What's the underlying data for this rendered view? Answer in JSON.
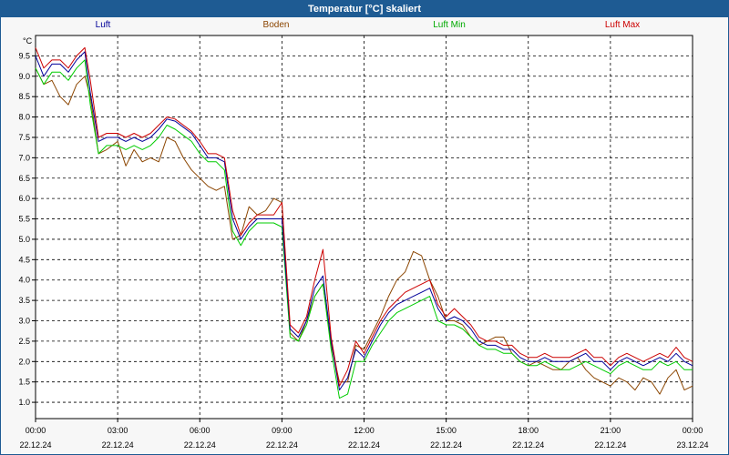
{
  "window": {
    "title": "Temperatur [°C] skaliert"
  },
  "colors": {
    "luft": "#000099",
    "boden": "#8b4500",
    "luft_min": "#00cc00",
    "luft_max": "#cc0000",
    "title_bar": "#1e5b93",
    "grid": "#000000"
  },
  "chart_data": {
    "type": "line",
    "title": "Temperatur [°C] skaliert",
    "ylabel": "°C",
    "xlabel": "",
    "ylim": [
      0.6,
      10.0
    ],
    "xlim": [
      0,
      24
    ],
    "grid": true,
    "legend_placement": "top",
    "y_ticks": [
      "1.0",
      "1.5",
      "2.0",
      "2.5",
      "3.0",
      "3.5",
      "4.0",
      "4.5",
      "5.0",
      "5.5",
      "6.0",
      "6.5",
      "7.0",
      "7.5",
      "8.0",
      "8.5",
      "9.0",
      "9.5"
    ],
    "y_tick_values": [
      1.0,
      1.5,
      2.0,
      2.5,
      3.0,
      3.5,
      4.0,
      4.5,
      5.0,
      5.5,
      6.0,
      6.5,
      7.0,
      7.5,
      8.0,
      8.5,
      9.0,
      9.5
    ],
    "x_ticks": [
      {
        "time": "00:00",
        "date": "22.12.24"
      },
      {
        "time": "03:00",
        "date": "22.12.24"
      },
      {
        "time": "06:00",
        "date": "22.12.24"
      },
      {
        "time": "09:00",
        "date": "22.12.24"
      },
      {
        "time": "12:00",
        "date": "22.12.24"
      },
      {
        "time": "15:00",
        "date": "22.12.24"
      },
      {
        "time": "18:00",
        "date": "22.12.24"
      },
      {
        "time": "21:00",
        "date": "22.12.24"
      },
      {
        "time": "00:00",
        "date": "23.12.24"
      }
    ],
    "series": [
      {
        "name": "Luft",
        "x": [
          0,
          0.3,
          0.6,
          0.9,
          1.2,
          1.5,
          1.8,
          2.0,
          2.3,
          2.6,
          3.0,
          3.3,
          3.6,
          3.9,
          4.2,
          4.5,
          4.8,
          5.1,
          5.4,
          5.7,
          6.0,
          6.3,
          6.6,
          6.9,
          7.2,
          7.5,
          7.8,
          8.1,
          8.4,
          8.7,
          9.0,
          9.3,
          9.6,
          9.9,
          10.2,
          10.5,
          10.8,
          11.1,
          11.4,
          11.7,
          12.0,
          12.3,
          12.6,
          12.9,
          13.2,
          13.5,
          13.8,
          14.1,
          14.4,
          14.7,
          15.0,
          15.3,
          15.6,
          15.9,
          16.2,
          16.5,
          16.8,
          17.1,
          17.4,
          17.7,
          18.0,
          18.3,
          18.6,
          18.9,
          19.2,
          19.5,
          19.8,
          20.1,
          20.4,
          20.7,
          21.0,
          21.3,
          21.6,
          21.9,
          22.2,
          22.5,
          22.8,
          23.1,
          23.4,
          23.7,
          24.0
        ],
        "values": [
          9.5,
          9.0,
          9.3,
          9.3,
          9.1,
          9.4,
          9.6,
          8.6,
          7.4,
          7.5,
          7.5,
          7.4,
          7.5,
          7.4,
          7.5,
          7.7,
          7.95,
          7.9,
          7.75,
          7.6,
          7.3,
          7.0,
          7.0,
          6.9,
          5.5,
          5.0,
          5.3,
          5.5,
          5.5,
          5.5,
          5.5,
          2.8,
          2.6,
          3.0,
          3.8,
          4.1,
          2.5,
          1.3,
          1.6,
          2.3,
          2.1,
          2.5,
          2.9,
          3.2,
          3.4,
          3.5,
          3.6,
          3.7,
          3.8,
          3.3,
          3.0,
          3.1,
          3.0,
          2.8,
          2.5,
          2.4,
          2.4,
          2.3,
          2.3,
          2.1,
          2.0,
          2.0,
          2.1,
          2.0,
          2.0,
          2.0,
          2.1,
          2.2,
          2.0,
          2.0,
          1.8,
          2.0,
          2.1,
          2.0,
          1.9,
          2.0,
          2.1,
          2.0,
          2.2,
          2.0,
          1.9
        ]
      },
      {
        "name": "Boden",
        "x": [
          0,
          0.3,
          0.6,
          0.9,
          1.2,
          1.5,
          1.8,
          2.0,
          2.3,
          2.6,
          3.0,
          3.3,
          3.6,
          3.9,
          4.2,
          4.5,
          4.8,
          5.1,
          5.4,
          5.7,
          6.0,
          6.3,
          6.6,
          6.9,
          7.2,
          7.5,
          7.8,
          8.1,
          8.4,
          8.7,
          9.0,
          9.3,
          9.6,
          9.9,
          10.2,
          10.5,
          10.8,
          11.1,
          11.4,
          11.7,
          12.0,
          12.3,
          12.6,
          12.9,
          13.2,
          13.5,
          13.8,
          14.1,
          14.4,
          14.7,
          15.0,
          15.3,
          15.6,
          15.9,
          16.2,
          16.5,
          16.8,
          17.1,
          17.4,
          17.7,
          18.0,
          18.3,
          18.6,
          18.9,
          19.2,
          19.5,
          19.8,
          20.1,
          20.4,
          20.7,
          21.0,
          21.3,
          21.6,
          21.9,
          22.2,
          22.5,
          22.8,
          23.1,
          23.4,
          23.7,
          24.0
        ],
        "values": [
          9.2,
          8.8,
          8.9,
          8.5,
          8.3,
          8.8,
          9.0,
          8.5,
          7.1,
          7.2,
          7.4,
          6.8,
          7.2,
          6.9,
          7.0,
          6.9,
          7.5,
          7.4,
          7.0,
          6.7,
          6.5,
          6.3,
          6.2,
          6.3,
          5.0,
          5.1,
          5.8,
          5.6,
          5.7,
          6.0,
          5.9,
          2.7,
          2.5,
          3.0,
          3.6,
          3.9,
          2.4,
          1.5,
          1.5,
          2.4,
          2.3,
          2.7,
          3.1,
          3.6,
          4.0,
          4.2,
          4.7,
          4.6,
          4.0,
          3.6,
          3.0,
          3.0,
          2.9,
          2.6,
          2.4,
          2.5,
          2.6,
          2.6,
          2.2,
          2.0,
          1.9,
          2.0,
          1.9,
          1.8,
          1.8,
          2.0,
          2.1,
          1.8,
          1.6,
          1.5,
          1.4,
          1.6,
          1.5,
          1.3,
          1.6,
          1.5,
          1.2,
          1.6,
          1.8,
          1.3,
          1.4
        ]
      },
      {
        "name": "Luft Min",
        "x": [
          0,
          0.3,
          0.6,
          0.9,
          1.2,
          1.5,
          1.8,
          2.0,
          2.3,
          2.6,
          3.0,
          3.3,
          3.6,
          3.9,
          4.2,
          4.5,
          4.8,
          5.1,
          5.4,
          5.7,
          6.0,
          6.3,
          6.6,
          6.9,
          7.2,
          7.5,
          7.8,
          8.1,
          8.4,
          8.7,
          9.0,
          9.3,
          9.6,
          9.9,
          10.2,
          10.5,
          10.8,
          11.1,
          11.4,
          11.7,
          12.0,
          12.3,
          12.6,
          12.9,
          13.2,
          13.5,
          13.8,
          14.1,
          14.4,
          14.7,
          15.0,
          15.3,
          15.6,
          15.9,
          16.2,
          16.5,
          16.8,
          17.1,
          17.4,
          17.7,
          18.0,
          18.3,
          18.6,
          18.9,
          19.2,
          19.5,
          19.8,
          20.1,
          20.4,
          20.7,
          21.0,
          21.3,
          21.6,
          21.9,
          22.2,
          22.5,
          22.8,
          23.1,
          23.4,
          23.7,
          24.0
        ],
        "values": [
          9.2,
          8.8,
          9.1,
          9.1,
          8.9,
          9.2,
          9.4,
          8.3,
          7.1,
          7.3,
          7.3,
          7.2,
          7.3,
          7.2,
          7.3,
          7.5,
          7.8,
          7.7,
          7.55,
          7.4,
          7.1,
          6.9,
          6.9,
          6.7,
          5.2,
          4.85,
          5.2,
          5.4,
          5.4,
          5.4,
          5.3,
          2.6,
          2.5,
          2.9,
          3.6,
          3.9,
          2.3,
          1.1,
          1.2,
          2.0,
          2.0,
          2.4,
          2.7,
          3.0,
          3.2,
          3.3,
          3.4,
          3.5,
          3.6,
          3.0,
          2.9,
          2.9,
          2.8,
          2.6,
          2.4,
          2.3,
          2.3,
          2.2,
          2.2,
          2.0,
          1.9,
          1.9,
          2.0,
          1.9,
          1.8,
          1.8,
          1.9,
          2.0,
          1.9,
          1.8,
          1.7,
          1.9,
          2.0,
          1.9,
          1.8,
          1.8,
          2.0,
          1.9,
          2.0,
          1.8,
          1.8
        ]
      },
      {
        "name": "Luft Max",
        "x": [
          0,
          0.3,
          0.6,
          0.9,
          1.2,
          1.5,
          1.8,
          2.0,
          2.3,
          2.6,
          3.0,
          3.3,
          3.6,
          3.9,
          4.2,
          4.5,
          4.8,
          5.1,
          5.4,
          5.7,
          6.0,
          6.3,
          6.6,
          6.9,
          7.2,
          7.5,
          7.8,
          8.1,
          8.4,
          8.7,
          9.0,
          9.3,
          9.6,
          9.9,
          10.2,
          10.5,
          10.8,
          11.1,
          11.4,
          11.7,
          12.0,
          12.3,
          12.6,
          12.9,
          13.2,
          13.5,
          13.8,
          14.1,
          14.4,
          14.7,
          15.0,
          15.3,
          15.6,
          15.9,
          16.2,
          16.5,
          16.8,
          17.1,
          17.4,
          17.7,
          18.0,
          18.3,
          18.6,
          18.9,
          19.2,
          19.5,
          19.8,
          20.1,
          20.4,
          20.7,
          21.0,
          21.3,
          21.6,
          21.9,
          22.2,
          22.5,
          22.8,
          23.1,
          23.4,
          23.7,
          24.0
        ],
        "values": [
          9.7,
          9.2,
          9.4,
          9.4,
          9.2,
          9.5,
          9.7,
          8.9,
          7.5,
          7.6,
          7.6,
          7.5,
          7.6,
          7.5,
          7.6,
          7.8,
          8.0,
          7.95,
          7.8,
          7.65,
          7.4,
          7.1,
          7.1,
          7.0,
          5.7,
          5.1,
          5.4,
          5.6,
          5.6,
          5.6,
          5.9,
          2.9,
          2.7,
          3.1,
          4.0,
          4.75,
          2.6,
          1.4,
          1.8,
          2.5,
          2.2,
          2.6,
          3.0,
          3.3,
          3.5,
          3.7,
          3.8,
          3.9,
          4.0,
          3.4,
          3.1,
          3.3,
          3.1,
          2.9,
          2.6,
          2.5,
          2.5,
          2.4,
          2.4,
          2.2,
          2.1,
          2.1,
          2.2,
          2.1,
          2.1,
          2.1,
          2.2,
          2.3,
          2.1,
          2.1,
          1.9,
          2.1,
          2.2,
          2.1,
          2.0,
          2.1,
          2.2,
          2.1,
          2.35,
          2.1,
          2.0
        ]
      }
    ]
  }
}
